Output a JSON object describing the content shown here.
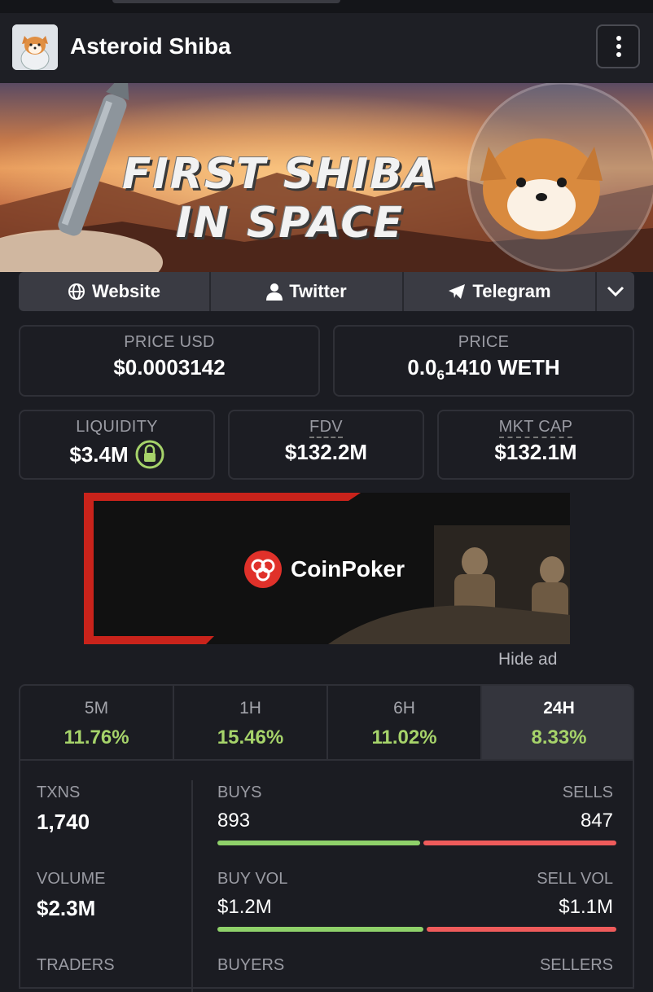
{
  "header": {
    "title": "Asteroid Shiba"
  },
  "banner": {
    "line1": "FIRST SHIBA",
    "line2": "IN SPACE"
  },
  "links": {
    "website": "Website",
    "twitter": "Twitter",
    "telegram": "Telegram"
  },
  "price_usd": {
    "label": "PRICE USD",
    "value": "$0.0003142"
  },
  "price": {
    "label": "PRICE",
    "prefix": "0.0",
    "subscript": "6",
    "suffix": "1410 WETH"
  },
  "liquidity": {
    "label": "LIQUIDITY",
    "value": "$3.4M"
  },
  "fdv": {
    "label": "FDV",
    "value": "$132.2M"
  },
  "mkt_cap": {
    "label": "MKT CAP",
    "value": "$132.1M"
  },
  "ad": {
    "brand": "CoinPoker",
    "hide_label": "Hide ad"
  },
  "timeframes": [
    {
      "label": "5M",
      "change": "11.76%"
    },
    {
      "label": "1H",
      "change": "15.46%"
    },
    {
      "label": "6H",
      "change": "11.02%"
    },
    {
      "label": "24H",
      "change": "8.33%",
      "active": true
    }
  ],
  "stats": {
    "txns": {
      "label": "TXNS",
      "value": "1,740"
    },
    "buys": {
      "label": "BUYS",
      "value": "893",
      "ratio": 0.513
    },
    "sells": {
      "label": "SELLS",
      "value": "847"
    },
    "volume": {
      "label": "VOLUME",
      "value": "$2.3M"
    },
    "buy_vol": {
      "label": "BUY VOL",
      "value": "$1.2M",
      "ratio": 0.52
    },
    "sell_vol": {
      "label": "SELL VOL",
      "value": "$1.1M"
    },
    "traders": {
      "label": "TRADERS"
    },
    "buyers": {
      "label": "BUYERS"
    },
    "sellers": {
      "label": "SELLERS"
    }
  },
  "colors": {
    "positive": "#a6d36a",
    "buy_bar": "#8fd16a",
    "sell_bar": "#ef5b5b",
    "accent_ad": "#c9231b"
  }
}
